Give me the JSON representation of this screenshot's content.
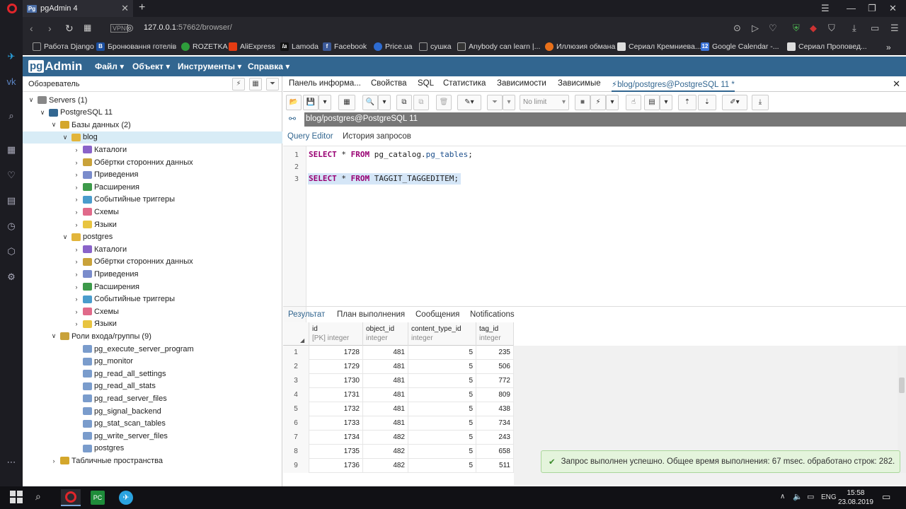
{
  "browser": {
    "tab_title": "pgAdmin 4",
    "tab_favicon": "Pg",
    "url_host": "127.0.0.1",
    "url_rest": ":57662/browser/",
    "vpn_label": "VPN"
  },
  "bookmarks": [
    {
      "label": "Работа Django",
      "icon": "folder-icon",
      "color": "#999999"
    },
    {
      "label": "Бронювання готелів",
      "icon": "b-icon",
      "color": "#1b4fa0"
    },
    {
      "label": "ROZETKA",
      "icon": "rozetka-icon",
      "color": "#2e9c3b"
    },
    {
      "label": "AliExpress",
      "icon": "aliexpress-icon",
      "color": "#e53c13"
    },
    {
      "label": "Lamoda",
      "icon": "lamoda-icon",
      "color": "#111111"
    },
    {
      "label": "Facebook",
      "icon": "facebook-icon",
      "color": "#3b5998"
    },
    {
      "label": "Price.ua",
      "icon": "price-icon",
      "color": "#2d6bd1"
    },
    {
      "label": "сушка",
      "icon": "folder-icon",
      "color": "#999999"
    },
    {
      "label": "Anybody can learn |...",
      "icon": "code-icon",
      "color": "#333333"
    },
    {
      "label": "Иллюзия обмана",
      "icon": "film-icon",
      "color": "#e8701a"
    },
    {
      "label": "Сериал Кремниева...",
      "icon": "page-icon",
      "color": "#dddddd"
    },
    {
      "label": "Google Calendar -...",
      "icon": "calendar-icon",
      "color": "#3b73d8"
    },
    {
      "label": "Сериал Проповед...",
      "icon": "page-icon",
      "color": "#dddddd"
    }
  ],
  "pgadmin": {
    "logo_pg": "pg",
    "logo_admin": "Admin",
    "menu": [
      "Файл ▾",
      "Объект ▾",
      "Инструменты ▾",
      "Справка ▾"
    ]
  },
  "tree": {
    "title": "Обозреватель",
    "servers": "Servers (1)",
    "server": "PostgreSQL 11",
    "databases": "Базы данных (2)",
    "db_blog": "blog",
    "db_postgres": "postgres",
    "db_children": [
      "Каталоги",
      "Обёртки сторонних данных",
      "Приведения",
      "Расширения",
      "Событийные триггеры",
      "Схемы",
      "Языки"
    ],
    "roles": "Роли входа/группы (9)",
    "role_items": [
      "pg_execute_server_program",
      "pg_monitor",
      "pg_read_all_settings",
      "pg_read_all_stats",
      "pg_read_server_files",
      "pg_signal_backend",
      "pg_stat_scan_tables",
      "pg_write_server_files",
      "postgres"
    ],
    "tablespaces": "Табличные пространства"
  },
  "right_tabs": [
    "Панель информа...",
    "Свойства",
    "SQL",
    "Статистика",
    "Зависимости",
    "Зависимые",
    "blog/postgres@PostgreSQL 11 *"
  ],
  "toolbar": {
    "limit_label": "No limit"
  },
  "connection": "blog/postgres@PostgreSQL 11",
  "query_tabs": [
    "Query Editor",
    "История запросов"
  ],
  "editor": {
    "line_numbers": [
      "1",
      "2",
      "3"
    ]
  },
  "result_tabs": [
    "Результат",
    "План выполнения",
    "Сообщения",
    "Notifications"
  ],
  "grid": {
    "columns": [
      {
        "name": "id",
        "type": "[PK] integer"
      },
      {
        "name": "object_id",
        "type": "integer"
      },
      {
        "name": "content_type_id",
        "type": "integer"
      },
      {
        "name": "tag_id",
        "type": "integer"
      }
    ],
    "rows": [
      [
        "1",
        "1728",
        "481",
        "5",
        "235"
      ],
      [
        "2",
        "1729",
        "481",
        "5",
        "506"
      ],
      [
        "3",
        "1730",
        "481",
        "5",
        "772"
      ],
      [
        "4",
        "1731",
        "481",
        "5",
        "809"
      ],
      [
        "5",
        "1732",
        "481",
        "5",
        "438"
      ],
      [
        "6",
        "1733",
        "481",
        "5",
        "734"
      ],
      [
        "7",
        "1734",
        "482",
        "5",
        "243"
      ],
      [
        "8",
        "1735",
        "482",
        "5",
        "658"
      ],
      [
        "9",
        "1736",
        "482",
        "5",
        "511"
      ]
    ]
  },
  "toast": "Запрос выполнен успешно. Общее время выполнения: 67 msec. обработано строк: 282.",
  "taskbar": {
    "lang": "ENG",
    "time": "15:58",
    "date": "23.08.2019"
  },
  "colors": {
    "pgadmin_blue": "#326690",
    "selection": "#d8ecf6",
    "success_bg": "#e4f4dc"
  }
}
